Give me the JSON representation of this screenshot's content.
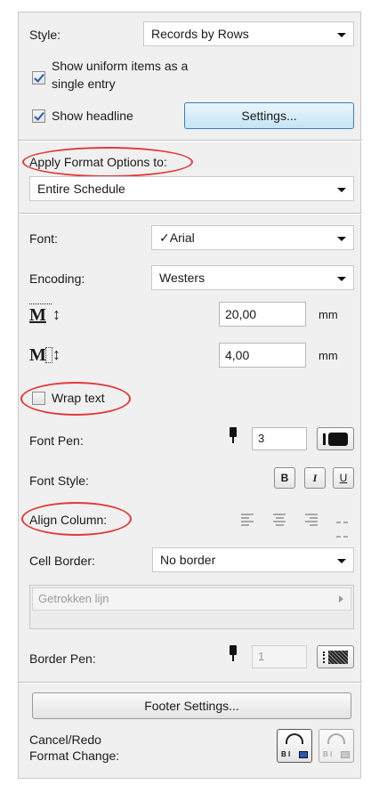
{
  "style_label": "Style:",
  "style_value": "Records by Rows",
  "uniform_items_label": "Show uniform items as a single entry",
  "uniform_items_line1": "Show uniform items as a",
  "uniform_items_line2": "single entry",
  "uniform_items_checked": true,
  "show_headline_label": "Show headline",
  "show_headline_checked": true,
  "settings_button": "Settings...",
  "apply_format_label": "Apply Format Options to:",
  "apply_format_value": "Entire Schedule",
  "font_label": "Font:",
  "font_value": "✓Arial",
  "encoding_label": "Encoding:",
  "encoding_value": "Westers",
  "size1_icon_text": "M",
  "size1_value": "20,00",
  "size1_unit": "mm",
  "size2_icon_text": "M",
  "size2_value": "4,00",
  "size2_unit": "mm",
  "wrap_text_label": "Wrap text",
  "wrap_text_checked": false,
  "font_pen_label": "Font Pen:",
  "font_pen_value": "3",
  "font_style_label": "Font Style:",
  "bold_label": "B",
  "italic_label": "I",
  "underline_label": "U",
  "align_column_label": "Align Column:",
  "cell_border_label": "Cell Border:",
  "cell_border_value": "No border",
  "line_type_value": "Getrokken lijn",
  "border_pen_label": "Border Pen:",
  "border_pen_value": "1",
  "footer_settings_button": "Footer Settings...",
  "cancel_redo_line1": "Cancel/Redo",
  "cancel_redo_line2": "Format Change:",
  "highlight_color": "#e23a3a",
  "accent_check_color": "#2a59b7"
}
